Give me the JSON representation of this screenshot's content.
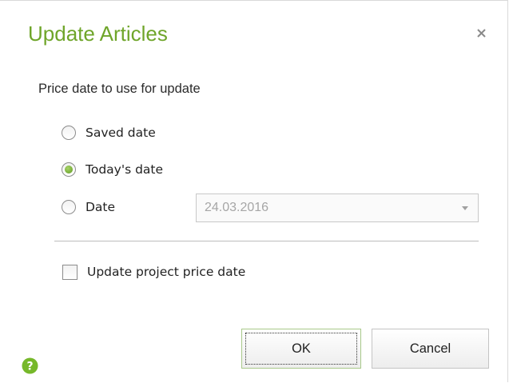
{
  "dialog": {
    "title": "Update Articles",
    "close_icon": "close-icon",
    "section_label": "Price date to use for update",
    "options": [
      {
        "label": "Saved date",
        "checked": false
      },
      {
        "label": "Today's date",
        "checked": true
      },
      {
        "label": "Date",
        "checked": false
      }
    ],
    "date_field": {
      "value": "24.03.2016",
      "enabled": false
    },
    "checkbox": {
      "label": "Update project price date",
      "checked": false
    },
    "buttons": {
      "ok": "OK",
      "cancel": "Cancel"
    },
    "help_icon": "help-icon"
  },
  "colors": {
    "accent": "#6fa52a",
    "help_icon": "#76b82a",
    "disabled_text": "#a6a6a6"
  }
}
